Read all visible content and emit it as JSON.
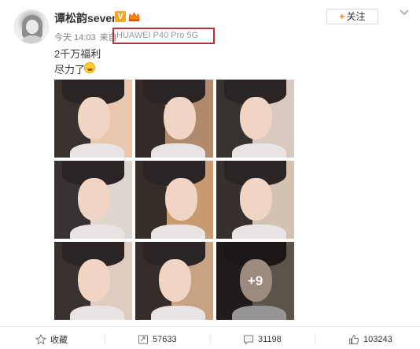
{
  "post": {
    "username": "谭松韵seven",
    "verified_badge": "V",
    "follow_label": "关注",
    "follow_plus": "+",
    "time": "今天 14:03",
    "source_prefix": "来自",
    "device": "HUAWEI P40 Pro 5G",
    "text_line1": "2千万福利",
    "text_line2": "尽力了",
    "more_photos": "+9",
    "photo_count_visible": 9
  },
  "actions": {
    "favorite_label": "收藏",
    "repost_count": "57633",
    "comment_count": "31198",
    "like_count": "103243"
  },
  "colors": {
    "accent_orange": "#ff8200",
    "badge_yellow": "#f5a623",
    "highlight_box": "#b83238",
    "meta_gray": "#808080"
  },
  "icons": [
    "star-icon",
    "repost-icon",
    "comment-icon",
    "like-icon",
    "chevron-down-icon",
    "crown-icon"
  ]
}
